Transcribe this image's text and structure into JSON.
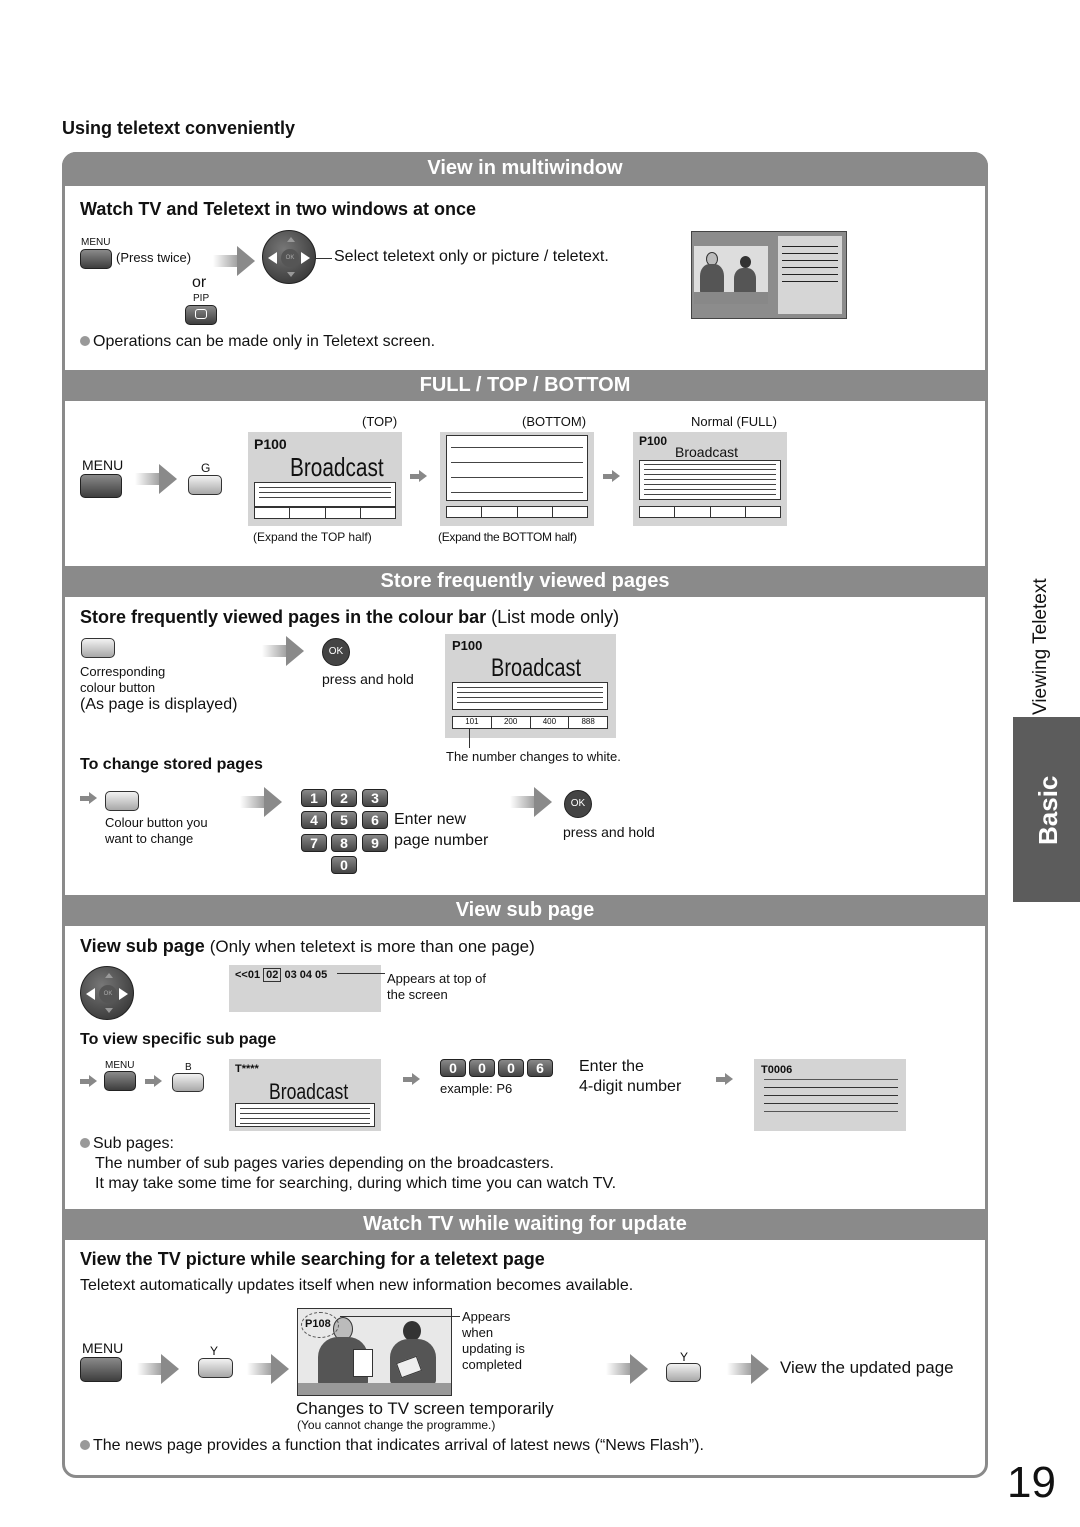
{
  "intro_heading": "Using teletext conveniently",
  "multiwindow": {
    "bar_title": "View in multiwindow",
    "heading": "Watch TV and Teletext in two windows at once",
    "menu_label": "MENU",
    "press_twice": "(Press twice)",
    "or": "or",
    "pip_label": "PIP",
    "select_text": "Select teletext only or picture / teletext.",
    "ok_label": "OK",
    "note": "Operations can be made only in Teletext screen."
  },
  "full_top_bottom": {
    "bar_title": "FULL / TOP / BOTTOM",
    "menu_label": "MENU",
    "g_label": "G",
    "top_label": "(TOP)",
    "bottom_label": "(BOTTOM)",
    "full_label": "Normal (FULL)",
    "page": "P100",
    "broadcast": "Broadcast",
    "expand_top": "(Expand the TOP half)",
    "expand_bottom": "(Expand the BOTTOM half)"
  },
  "store_pages": {
    "bar_title": "Store frequently viewed pages",
    "heading": "Store frequently viewed pages in the colour bar",
    "heading_note": "(List mode only)",
    "corresponding": "Corresponding",
    "colour_button": "colour button",
    "as_displayed": "(As page is displayed)",
    "ok_label": "OK",
    "press_hold": "press and hold",
    "page": "P100",
    "broadcast": "Broadcast",
    "stored": [
      "101",
      "200",
      "400",
      "888"
    ],
    "number_white": "The number changes to white.",
    "change_heading": "To change stored pages",
    "colour_change_1": "Colour button you",
    "colour_change_2": "want to change",
    "keys": [
      "1",
      "2",
      "3",
      "4",
      "5",
      "6",
      "7",
      "8",
      "9",
      "0"
    ],
    "enter_new": "Enter new",
    "page_number": "page number",
    "press_hold_2": "press and hold"
  },
  "sub_page": {
    "bar_title": "View sub page",
    "heading": "View sub page",
    "heading_note": "(Only when teletext is more than one page)",
    "ok_label": "OK",
    "sub_prefix": "<<01",
    "sub_current": "02",
    "sub_rest": "03 04 05",
    "appears_1": "Appears at top of",
    "appears_2": "the screen",
    "specific_heading": "To view specific sub page",
    "menu_label": "MENU",
    "b_label": "B",
    "t_label": "T****",
    "broadcast": "Broadcast",
    "digits": [
      "0",
      "0",
      "0",
      "6"
    ],
    "example": "example: P6",
    "enter_1": "Enter the",
    "enter_2": "4-digit number",
    "result_label": "T0006",
    "note_title": "Sub pages:",
    "note_1": "The number of sub pages varies depending on the broadcasters.",
    "note_2": "It may take some time for searching, during which time you can watch TV."
  },
  "update": {
    "bar_title": "Watch TV while waiting for update",
    "heading": "View the TV picture while searching for a teletext page",
    "desc": "Teletext automatically updates itself when new information becomes available.",
    "menu_label": "MENU",
    "y_label": "Y",
    "page_badge": "P108",
    "appears_1": "Appears",
    "appears_2": "when",
    "appears_3": "updating is",
    "appears_4": "completed",
    "changes": "Changes to TV screen temporarily",
    "cannot": "(You cannot change the programme.)",
    "y_label_2": "Y",
    "view_updated": "View the updated page",
    "note": "The news page provides a function that indicates arrival of latest news (“News Flash”)."
  },
  "side": {
    "section": "Viewing Teletext",
    "tab": "Basic"
  },
  "page_number": "19"
}
